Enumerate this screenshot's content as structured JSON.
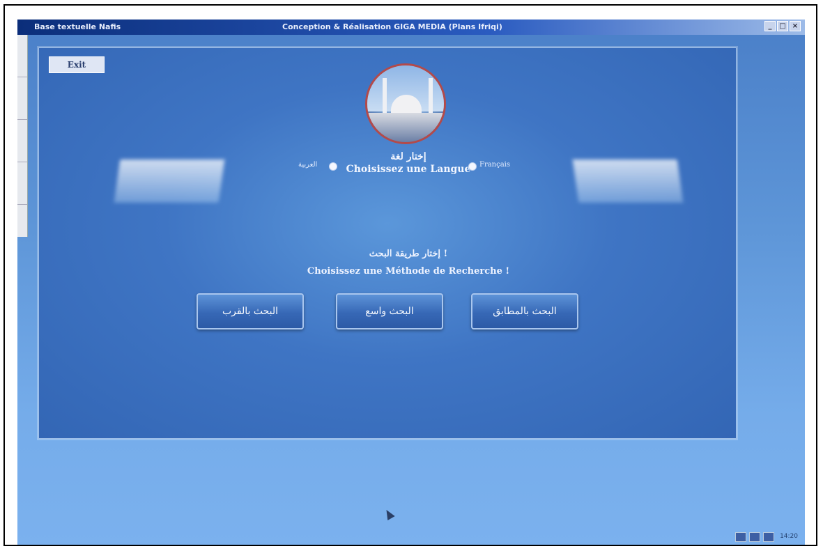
{
  "window": {
    "app_name": "Base textuelle Nafis",
    "title": "Conception & Réalisation GIGA MEDIA (Plans Ifriqi)",
    "controls": [
      "_",
      "□",
      "×"
    ]
  },
  "panel": {
    "exit_label": "Exit",
    "language_prompt_ar": "إختار لغة",
    "language_prompt_fr": "Choisissez une Langue",
    "language_options": [
      "العربية",
      "Français"
    ],
    "method_prompt_ar": "إختار طريقة البحث !",
    "method_prompt_fr": "Choisissez une Méthode de Recherche !",
    "search_buttons": [
      "البحث بالقرب",
      "البحث واسع",
      "البحث بالمطابق"
    ]
  },
  "taskbar": {
    "clock": "14:20"
  },
  "icons": {
    "emblem": "mosque-emblem-icon",
    "cursor": "mouse-cursor-icon"
  },
  "colors": {
    "panel_blue": "#3f75c4",
    "desktop_blue": "#75acea",
    "titlebar": "#0b2e7a"
  }
}
